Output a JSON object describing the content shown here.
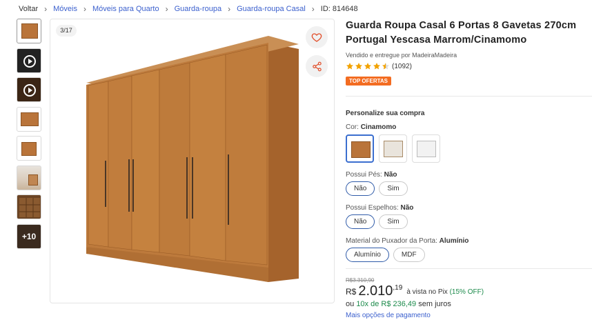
{
  "breadcrumb": {
    "back": "Voltar",
    "items": [
      "Móveis",
      "Móveis para Quarto",
      "Guarda-roupa",
      "Guarda-roupa Casal"
    ],
    "id": "ID: 814648"
  },
  "gallery": {
    "counter": "3/17",
    "more_label": "+10",
    "thumbnails": [
      "wardrobe-photo",
      "video",
      "video",
      "wardrobe-photo",
      "wardrobe-photo",
      "room-photo",
      "open-wardrobe-photo",
      "more"
    ]
  },
  "product": {
    "title": "Guarda Roupa Casal 6 Portas 8 Gavetas 270cm Portugal Yescasa Marrom/Cinamomo",
    "seller": "Vendido e entregue por MadeiraMadeira",
    "rating_stars": 4.5,
    "review_count": "(1092)",
    "badge": "TOP OFERTAS"
  },
  "customize": {
    "title": "Personalize sua compra",
    "color_label": "Cor:",
    "color_value": "Cinamomo",
    "colors": [
      {
        "name": "cinamomo",
        "hex": "#b9743a",
        "selected": true
      },
      {
        "name": "offwhite-wood",
        "hex": "#e9e4dc",
        "selected": false
      },
      {
        "name": "white",
        "hex": "#f2f2f2",
        "selected": false
      }
    ],
    "options": [
      {
        "label": "Possui Pés:",
        "value": "Não",
        "choices": [
          "Não",
          "Sim"
        ],
        "selected": 0
      },
      {
        "label": "Possui Espelhos:",
        "value": "Não",
        "choices": [
          "Não",
          "Sim"
        ],
        "selected": 0
      },
      {
        "label": "Material do Puxador da Porta:",
        "value": "Alumínio",
        "choices": [
          "Alumínio",
          "MDF"
        ],
        "selected": 0
      }
    ]
  },
  "price": {
    "old": "R$3.310,90",
    "currency": "R$",
    "int": "2.010",
    "cents": ",19",
    "pix": "à vista no Pix",
    "pix_off": "(15% OFF)",
    "inst_pre": "ou",
    "inst_green": "10x de R$ 236,49",
    "inst_post": "sem juros",
    "more_payment": "Mais opções de pagamento"
  },
  "colors": {
    "accent": "#3a5fcd",
    "badge": "#f36c21",
    "green": "#1b8a4a",
    "wood": "#b9743a"
  }
}
